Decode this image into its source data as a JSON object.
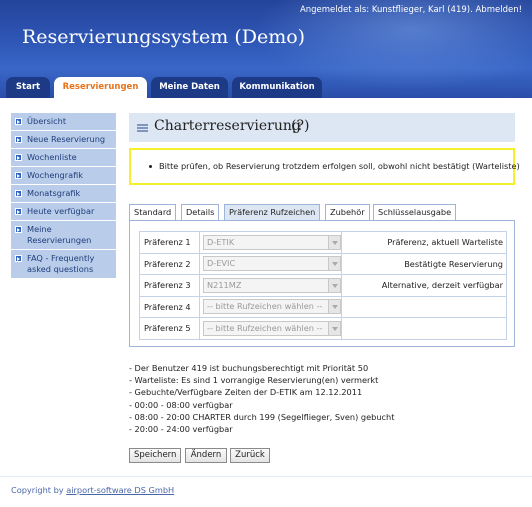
{
  "header": {
    "login_prefix": "Angemeldet als: Kunstflieger, Karl (419).",
    "logout": "Abmelden!",
    "app_title": "Reservierungssystem (Demo)"
  },
  "tabs": [
    {
      "label": "Start"
    },
    {
      "label": "Reservierungen"
    },
    {
      "label": "Meine Daten"
    },
    {
      "label": "Kommunikation"
    }
  ],
  "sidebar": {
    "items": [
      {
        "label": "Übersicht"
      },
      {
        "label": "Neue Reservierung"
      },
      {
        "label": "Wochenliste"
      },
      {
        "label": "Wochengrafik"
      },
      {
        "label": "Monatsgrafik"
      },
      {
        "label": "Heute verfügbar"
      },
      {
        "label": "Meine Reservierungen"
      },
      {
        "label": "FAQ - Frequently asked questions"
      }
    ]
  },
  "page": {
    "title": "Charterreservierung",
    "help": "(?)"
  },
  "warning": "Bitte prüfen, ob Reservierung trotzdem erfolgen soll, obwohl nicht bestätigt (Warteliste)",
  "subtabs": [
    {
      "label": "Standard"
    },
    {
      "label": "Details"
    },
    {
      "label": "Präferenz Rufzeichen"
    },
    {
      "label": "Zubehör"
    },
    {
      "label": "Schlüsselausgabe"
    }
  ],
  "preferences": [
    {
      "label": "Präferenz 1",
      "value": "D-ETIK",
      "desc": "Präferenz, aktuell Warteliste"
    },
    {
      "label": "Präferenz 2",
      "value": "D-EVIC",
      "desc": "Bestätigte Reservierung"
    },
    {
      "label": "Präferenz 3",
      "value": "N211MZ",
      "desc": "Alternative, derzeit verfügbar"
    },
    {
      "label": "Präferenz 4",
      "value": "-- bitte Rufzeichen wählen --",
      "desc": ""
    },
    {
      "label": "Präferenz 5",
      "value": "-- bitte Rufzeichen wählen --",
      "desc": ""
    }
  ],
  "info": [
    "- Der Benutzer 419 ist buchungsberechtigt mit Priorität 50",
    "- Warteliste: Es sind 1 vorrangige Reservierung(en) vermerkt",
    "- Gebuchte/Verfügbare Zeiten der D-ETIK am 12.12.2011",
    "- 00:00 - 08:00 verfügbar",
    "- 08:00 - 20:00 CHARTER durch 199 (Segelflieger, Sven) gebucht",
    "- 20:00 - 24:00 verfügbar"
  ],
  "buttons": {
    "save": "Speichern",
    "change": "Ändern",
    "back": "Zurück"
  },
  "footer": {
    "prefix": "Copyright by",
    "link": "airport-software DS GmbH"
  }
}
